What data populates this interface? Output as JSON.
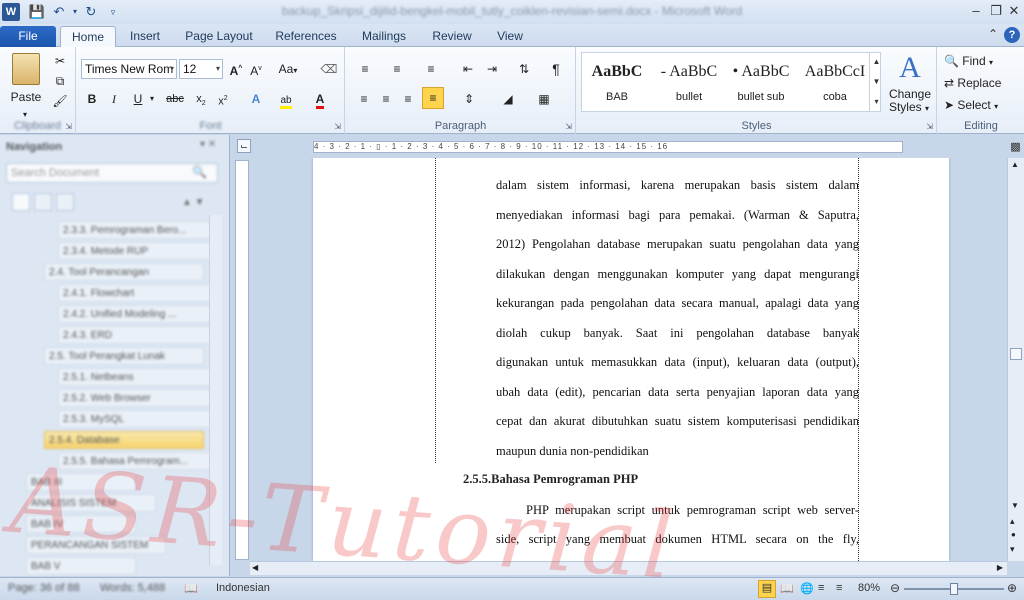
{
  "titlebar": {
    "title": "backup_Skripsi_dijilid-bengkel-mobil_tutly_coiklen-revisian-semi.docx - Microsoft Word",
    "logo": "W",
    "icons": [
      "save-icon",
      "undo-icon",
      "redo-icon",
      "customize-icon"
    ]
  },
  "tabs": [
    {
      "label": "File"
    },
    {
      "label": "Home"
    },
    {
      "label": "Insert"
    },
    {
      "label": "Page Layout"
    },
    {
      "label": "References"
    },
    {
      "label": "Mailings"
    },
    {
      "label": "Review"
    },
    {
      "label": "View"
    }
  ],
  "ribbon": {
    "clipboard": {
      "paste": "Paste",
      "label": "Clipboard"
    },
    "font": {
      "name": "Times New Rom",
      "size": "12",
      "label": "Font",
      "change_case": "Aa"
    },
    "paragraph": {
      "label": "Paragraph"
    },
    "styles": {
      "label": "Styles",
      "cards": [
        {
          "preview": "AaBbC",
          "name": "BAB"
        },
        {
          "preview": "- AaBbC",
          "name": "bullet"
        },
        {
          "preview": "• AaBbC",
          "name": "bullet sub"
        },
        {
          "preview": "AaBbCcI",
          "name": "coba"
        }
      ],
      "change_styles_line1": "Change",
      "change_styles_line2": "Styles"
    },
    "editing": {
      "label": "Editing",
      "find": "Find",
      "replace": "Replace",
      "select": "Select"
    }
  },
  "nav": {
    "title": "Navigation",
    "search_placeholder": "Search Document",
    "items": [
      {
        "label": "2.3.3. Pemrograman Bero..."
      },
      {
        "label": "2.3.4. Metode RUP"
      },
      {
        "label": "2.4. Tool Perancangan"
      },
      {
        "label": "2.4.1. Flowchart"
      },
      {
        "label": "2.4.2. Unified Modeling ..."
      },
      {
        "label": "2.4.3. ERD"
      },
      {
        "label": "2.5. Tool Perangkat Lunak"
      },
      {
        "label": "2.5.1. Netbeans"
      },
      {
        "label": "2.5.2. Web Browser"
      },
      {
        "label": "2.5.3. MySQL"
      },
      {
        "label": "2.5.4. Database"
      },
      {
        "label": "2.5.5. Bahasa Pemrogram..."
      },
      {
        "label": "BAB III"
      },
      {
        "label": "ANALISIS SISTEM"
      },
      {
        "label": "BAB IV"
      },
      {
        "label": "PERANCANGAN SISTEM"
      },
      {
        "label": "BAB V"
      }
    ]
  },
  "ruler": {
    "ticks": "4 · 3 · 2 · 1 · ▯ · 1 · 2 · 3 · 4 · 5 · 6 · 7 · 8 · 9 · 10 · 11 · 12 · 13 · 14 · 15 · 16"
  },
  "document": {
    "lines": [
      "dalam sistem informasi, karena merupakan basis sistem dalam",
      "menyediakan informasi bagi para pemakai. (Warman & Saputra,",
      "2012) Pengolahan database merupakan suatu pengolahan data yang",
      "dilakukan dengan menggunakan komputer yang dapat mengurangi",
      "kekurangan pada pengolahan data secara manual, apalagi data yang",
      "diolah cukup banyak. Saat ini pengolahan database banyak",
      "digunakan untuk memasukkan data (input), keluaran data (output),",
      "ubah data (edit), pencarian data serta penyajian laporan data yang",
      "cepat dan akurat dibutuhkan suatu sistem komputerisasi pendidikan",
      "maupun dunia non-pendidikan"
    ],
    "heading": "2.5.5.Bahasa Pemrograman PHP",
    "para2": [
      "PHP merupakan script untuk pemrograman script web server-",
      "side, script yang membuat dokumen HTML secara on the fly,"
    ]
  },
  "status": {
    "page": "Page: 36 of 88",
    "words": "Words: 5,488",
    "language": "Indonesian",
    "zoom": "80%",
    "zoom_level": 0.5
  },
  "watermark": "ASR-Tutorial"
}
